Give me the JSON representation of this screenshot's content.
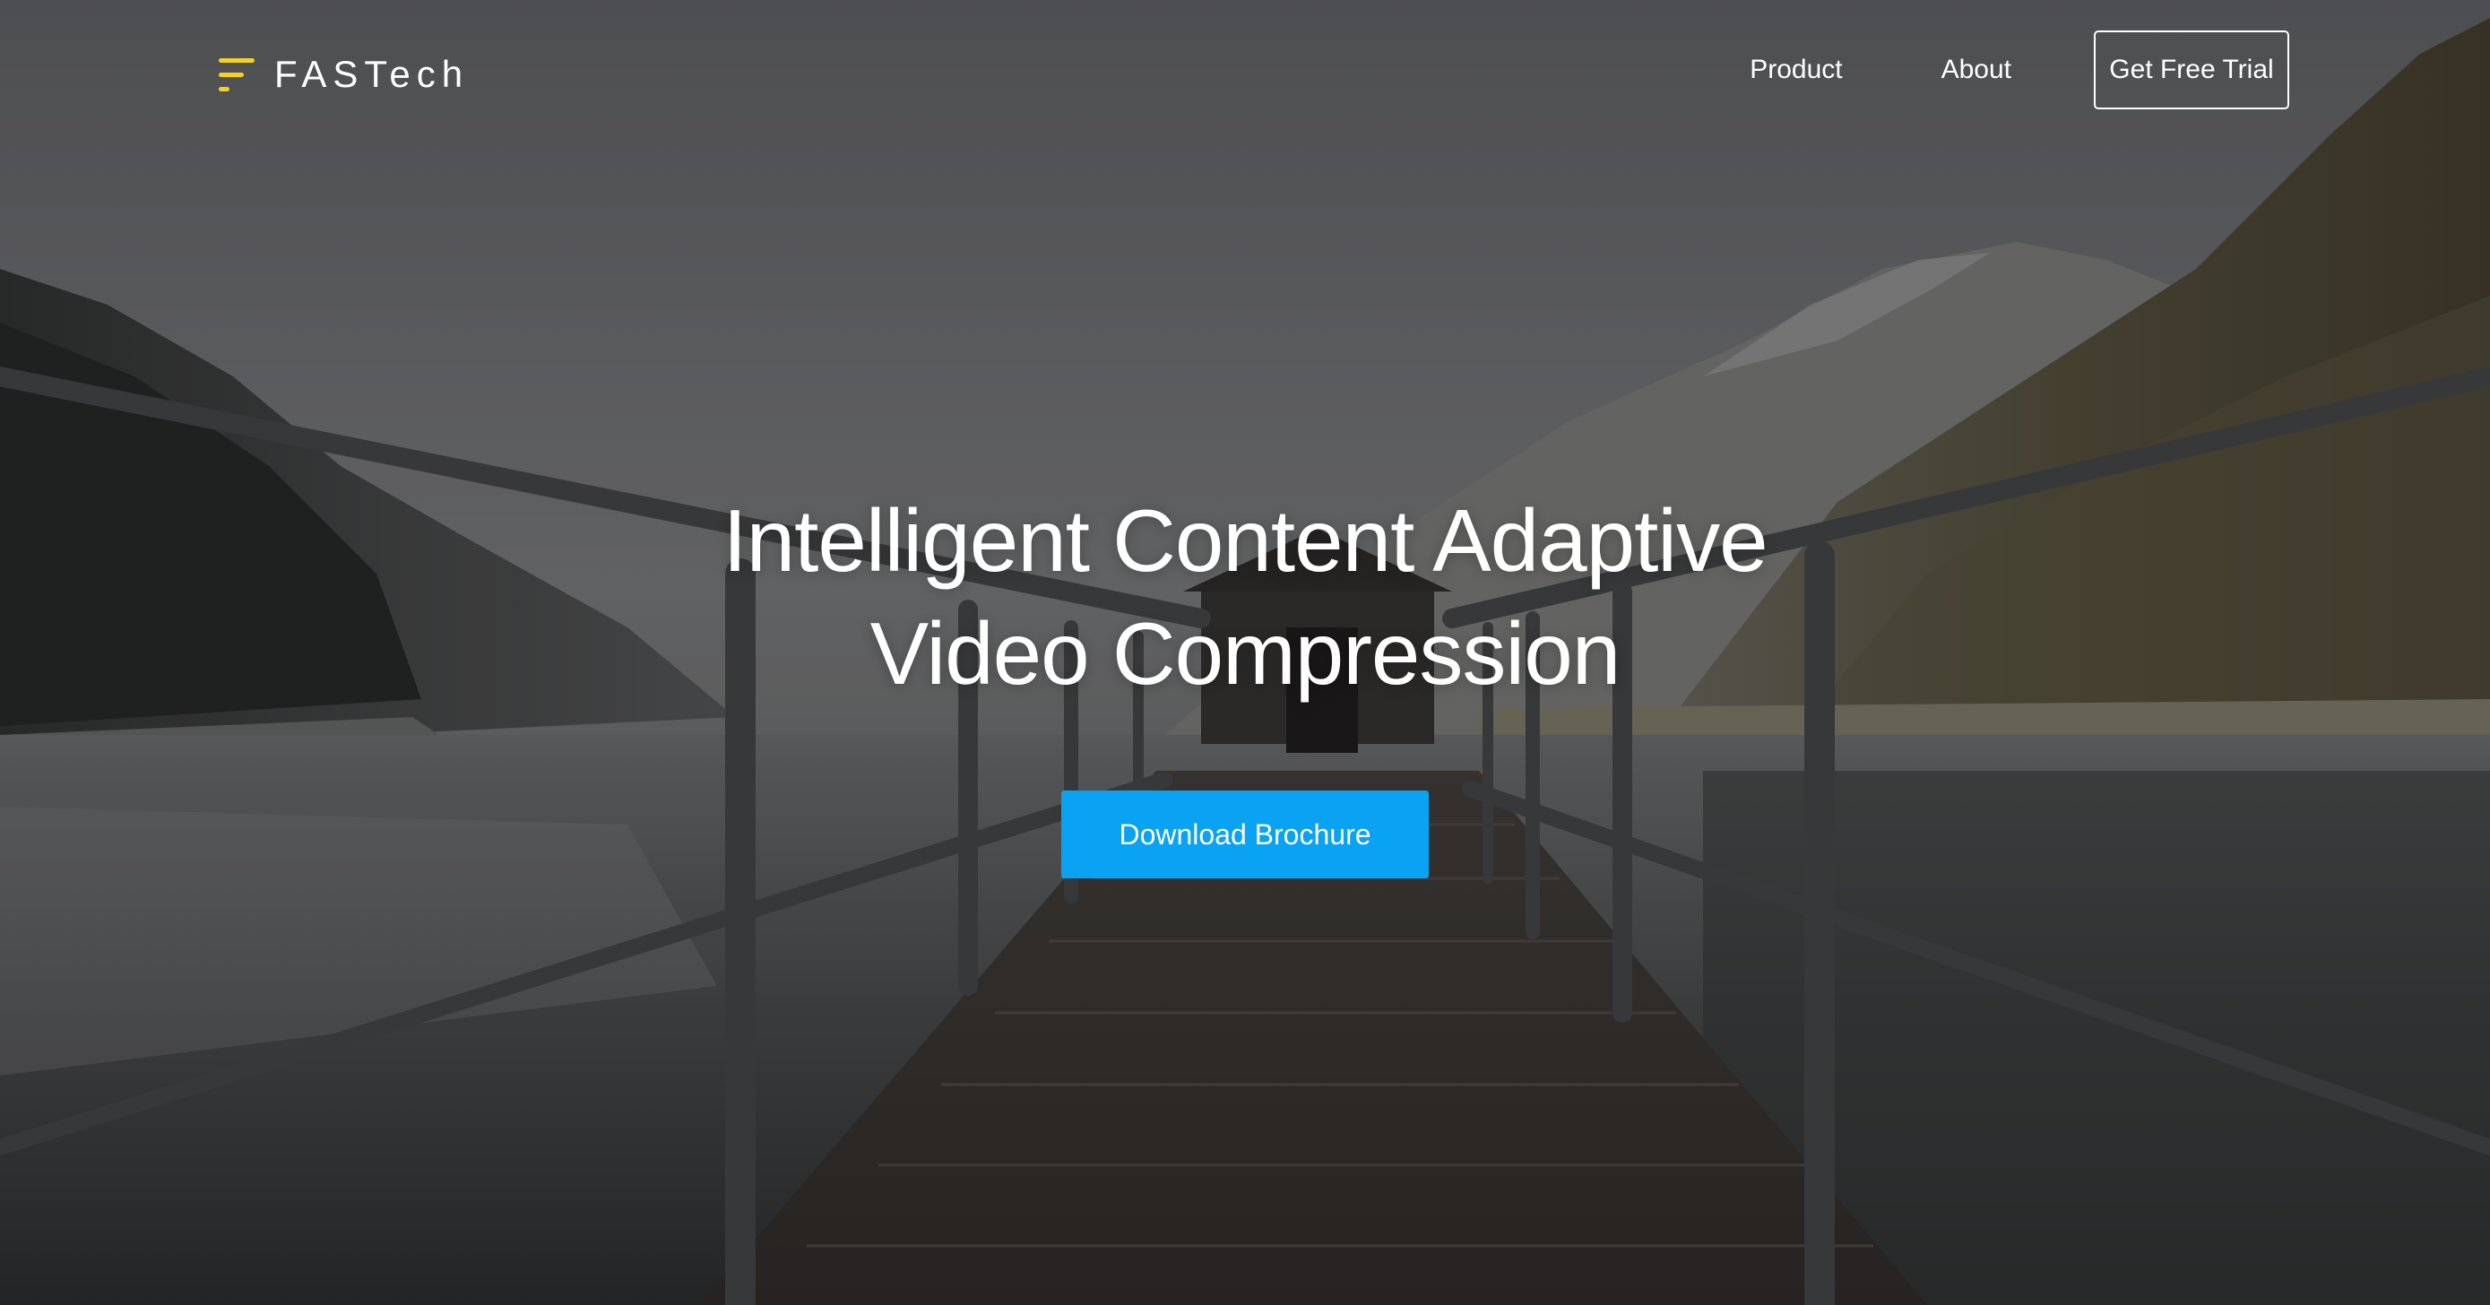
{
  "brand": {
    "name": "FASTech",
    "logo_color": "#f5d21f"
  },
  "nav": {
    "items": [
      {
        "label": "Product"
      },
      {
        "label": "About"
      }
    ],
    "cta_label": "Get Free Trial"
  },
  "hero": {
    "headline_line1": "Intelligent Content Adaptive",
    "headline_line2": "Video Compression",
    "button_label": "Download Brochure",
    "button_color": "#0aa2f2"
  }
}
